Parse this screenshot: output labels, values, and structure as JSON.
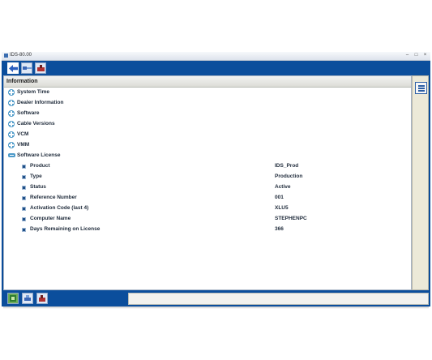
{
  "window": {
    "title": "IDS-80.00"
  },
  "panel": {
    "header": "Information",
    "tree": [
      {
        "label": "System Time"
      },
      {
        "label": "Dealer Information"
      },
      {
        "label": "Software"
      },
      {
        "label": "Cable Versions"
      },
      {
        "label": "VCM"
      },
      {
        "label": "VMM"
      },
      {
        "label": "Software License"
      }
    ],
    "license": [
      {
        "label": "Product",
        "value": "IDS_Prod"
      },
      {
        "label": "Type",
        "value": "Production"
      },
      {
        "label": "Status",
        "value": "Active"
      },
      {
        "label": "Reference Number",
        "value": "001"
      },
      {
        "label": "Activation Code (last 4)",
        "value": "XLU5"
      },
      {
        "label": "Computer Name",
        "value": "STEPHENPC"
      },
      {
        "label": "Days Remaining on License",
        "value": "366"
      }
    ]
  },
  "colors": {
    "chrome_blue": "#0b4e9c",
    "node_icon": "#4d9ac9",
    "panel_bg": "#ffffff"
  },
  "icons": {
    "toolbar": [
      "back-arrow-icon",
      "connector-icon",
      "tools-icon"
    ],
    "statusbar": [
      "network-icon",
      "vehicle-icon",
      "tools-icon"
    ],
    "right": "list-icon"
  }
}
